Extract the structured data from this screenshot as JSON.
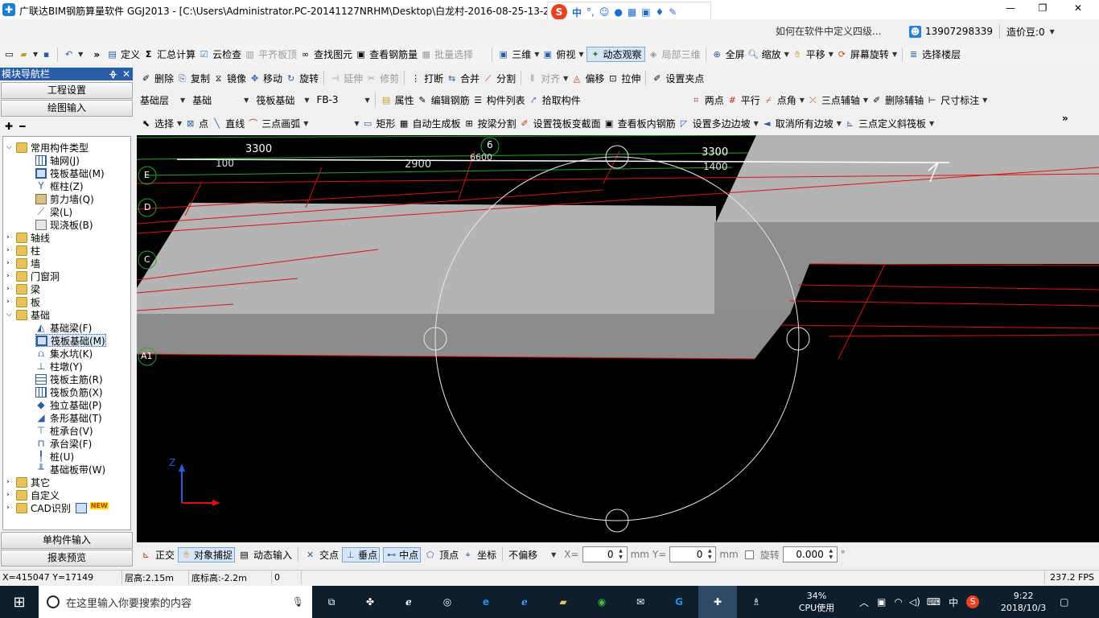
{
  "title": "广联达BIM钢筋算量软件 GGJ2013 - [C:\\Users\\Administrator.PC-20141127NRHM\\Desktop\\白龙村-2016-08-25-13-27",
  "title_tail": "...",
  "ime_bar": {
    "badge": "S",
    "zh": "中",
    "punct": "°,"
  },
  "win": {
    "min": "—",
    "max": "❐",
    "close": "✕"
  },
  "tb1": {
    "define": "定义",
    "sum": "汇总计算",
    "cloud": "云检查",
    "flat": "平齐板顶",
    "find": "查找图元",
    "view_rebar": "查看钢筋量",
    "batch": "批量选择",
    "d3": "三维",
    "top": "俯视",
    "dyn": "动态观察",
    "local3d": "局部三维",
    "full": "全屏",
    "zoom": "缩放",
    "pan": "平移",
    "rotate": "屏幕旋转",
    "floor": "选择楼层"
  },
  "question": "如何在软件中定义四级...",
  "user_phone": "13907298339",
  "coins": "造价豆:0",
  "nav": {
    "title": "模块导航栏",
    "pin": "ᚖ",
    "close": "✕",
    "proj": "工程设置",
    "draw": "绘图输入",
    "single": "单构件输入",
    "report": "报表预览"
  },
  "tb2": {
    "del": "删除",
    "copy": "复制",
    "mirror": "镜像",
    "move": "移动",
    "rot": "旋转",
    "extend": "延伸",
    "trim": "修剪",
    "break": "打断",
    "merge": "合并",
    "split": "分割",
    "align": "对齐",
    "offset": "偏移",
    "stretch": "拉伸",
    "grip": "设置夹点"
  },
  "tb3": {
    "layer": "基础层",
    "cat": "基础",
    "type": "筏板基础",
    "elem": "FB-3",
    "prop": "属性",
    "edit_rebar": "编辑钢筋",
    "list": "构件列表",
    "pick": "拾取构件",
    "twopt": "两点",
    "parallel": "平行",
    "ptangle": "点角",
    "threeaux": "三点辅轴",
    "delaux": "删除辅轴",
    "dim": "尺寸标注"
  },
  "tb4": {
    "select": "选择",
    "point": "点",
    "line": "直线",
    "arc": "三点画弧",
    "rect": "矩形",
    "autogen": "自动生成板",
    "beamsplit": "按梁分割",
    "varsec": "设置筏板变截面",
    "viewin": "查看板内钢筋",
    "multislope": "设置多边边坡",
    "cancelslope": "取消所有边坡",
    "slope3": "三点定义斜筏板"
  },
  "tree": {
    "common": "常用构件类型",
    "axis_grid": "轴网(J)",
    "raft": "筏板基础(M)",
    "frame_col": "框柱(Z)",
    "shear_wall": "剪力墙(Q)",
    "beam": "梁(L)",
    "cast_slab": "现浇板(B)",
    "g_axis": "轴线",
    "g_col": "柱",
    "g_wall": "墙",
    "g_door": "门窗洞",
    "g_beam": "梁",
    "g_slab": "板",
    "g_found": "基础",
    "f_beam": "基础梁(F)",
    "f_raft": "筏板基础(M)",
    "f_pit": "集水坑(K)",
    "f_pier": "柱墩(Y)",
    "f_main": "筏板主筋(R)",
    "f_neg": "筏板负筋(X)",
    "f_iso": "独立基础(P)",
    "f_strip": "条形基础(T)",
    "f_pilecap": "桩承台(V)",
    "f_capbeam": "承台梁(F)",
    "f_pile": "桩(U)",
    "f_band": "基础板带(W)",
    "g_other": "其它",
    "g_custom": "自定义",
    "g_cad": "CAD识别",
    "new_badge": "NEW"
  },
  "canvas": {
    "d1": "3300",
    "d2": "100",
    "d3": "2900",
    "d4": "6600",
    "d5": "3300",
    "d6": "1400",
    "axis6": "6",
    "aE": "E",
    "aD": "D",
    "aC": "C",
    "aA": "A1",
    "z": "Z"
  },
  "snap": {
    "ortho": "正交",
    "osnap": "对象捕捉",
    "dyninput": "动态输入",
    "inter": "交点",
    "perp": "垂点",
    "mid": "中点",
    "vertex": "顶点",
    "coord": "坐标",
    "offset": "不偏移",
    "x_label": "X=",
    "x": "0",
    "mm1": "mm",
    "y_label": "Y=",
    "y": "0",
    "mm2": "mm",
    "rot": "旋转",
    "rotv": "0.000",
    "deg": "°"
  },
  "status": {
    "xy": "X=415047 Y=17149",
    "floorh": "层高:2.15m",
    "bottom": "底标高:-2.2m",
    "zero": "0",
    "fps": "237.2 FPS"
  },
  "taskbar": {
    "search": "在这里输入你要搜索的内容",
    "cpu": "34%",
    "cpu_label": "CPU使用",
    "ime": "中",
    "time": "9:22",
    "date": "2018/10/3"
  },
  "colors": {
    "slab_light": "#b4b4b4",
    "slab_dark": "#8c8c8c",
    "red_line": "#e01010",
    "green_line": "#22aa22",
    "taskbar": "#0f1e2d",
    "nav_title": "#2a5da8"
  }
}
